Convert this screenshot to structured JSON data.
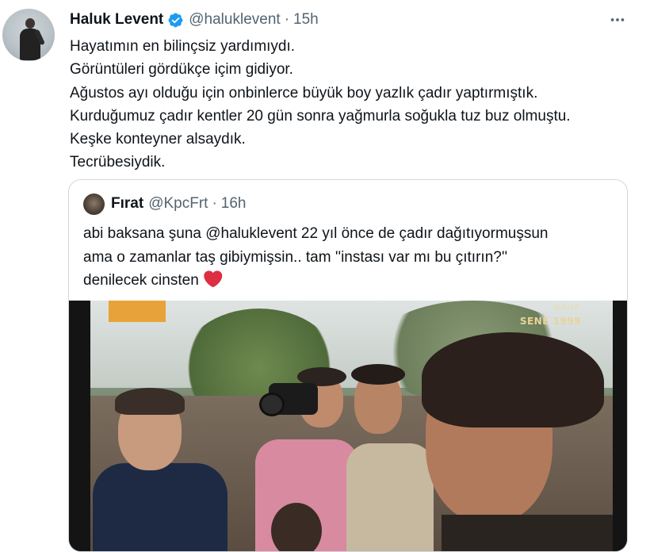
{
  "tweet": {
    "author": {
      "name": "Haluk Levent",
      "handle": "@haluklevent",
      "separator": "·",
      "time": "15h",
      "verified_color": "#1d9bf0"
    },
    "lines": [
      "Hayatımın en bilinçsiz yardımıydı.",
      "Görüntüleri gördükçe içim gidiyor.",
      "Ağustos ayı olduğu için onbinlerce büyük boy yazlık çadır yaptırmıştık.",
      "Kurduğumuz çadır kentler 20 gün sonra yağmurla soğukla tuz buz olmuştu.",
      "Keşke konteyner alsaydık.",
      "Tecrübesiydik."
    ],
    "more_icon": "more-horizontal-icon"
  },
  "quoted": {
    "author": {
      "name": "Fırat",
      "handle": "@KpcFrt",
      "separator": "·",
      "time": "16h"
    },
    "lines": [
      "abi baksana şuna @haluklevent 22 yıl önce de çadır dağıtıyormuşsun",
      "ama o zamanlar taş gibiymişsin.. tam ''instası var mı bu çıtırın?''",
      "denilecek cinsten"
    ],
    "emoji": "red-heart-icon",
    "emoji_color": "#dd2e44",
    "video": {
      "channel_overlay": "GÜNLER",
      "year_overlay": "SENE 1999"
    }
  },
  "colors": {
    "text_primary": "#0f1419",
    "text_secondary": "#536471",
    "border": "#cfd9de"
  }
}
